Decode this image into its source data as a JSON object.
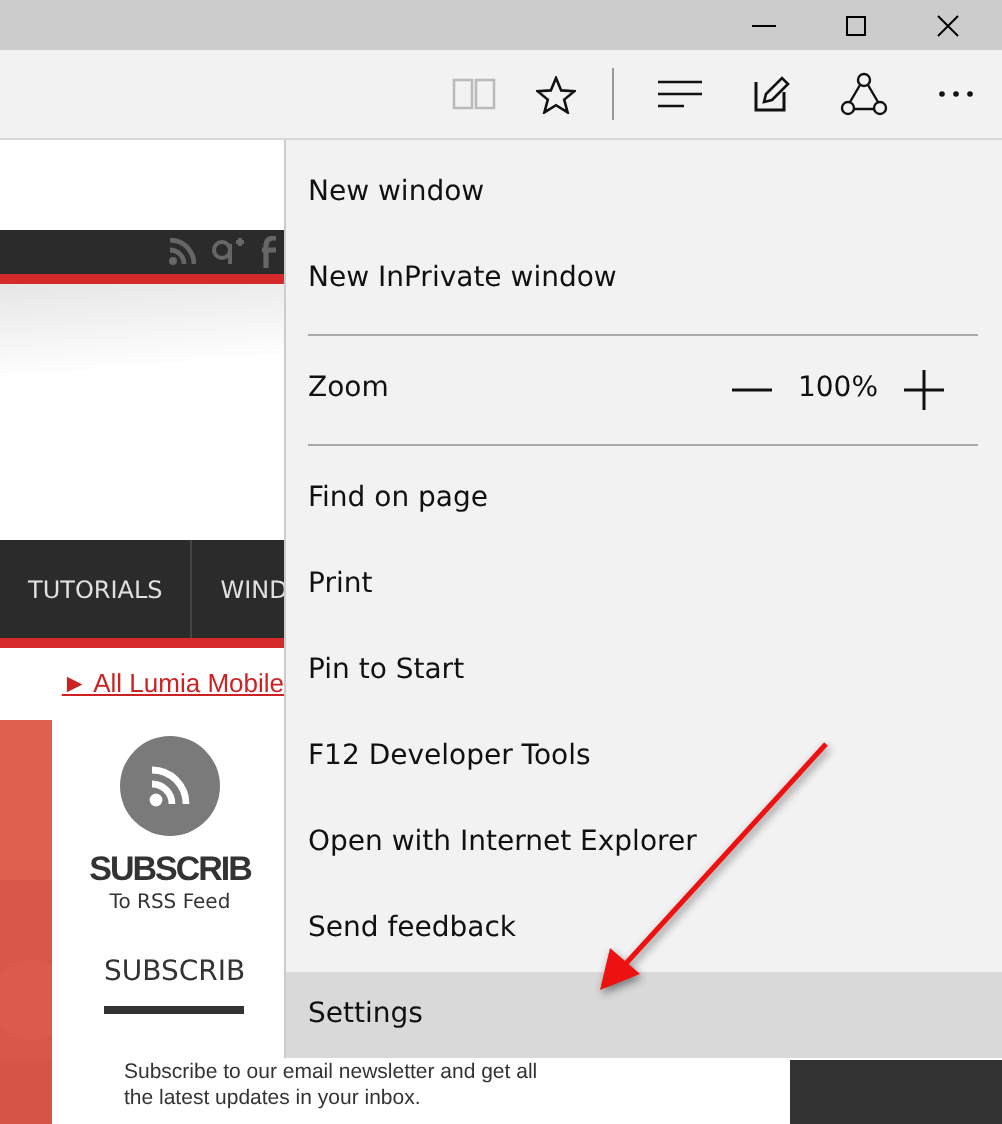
{
  "toolbar": {
    "reading_view_disabled": true
  },
  "site": {
    "nav_items": [
      "TUTORIALS",
      "WIND"
    ],
    "ticker_link": "► All Lumia Mobile",
    "rss_title": "SUBSCRIB",
    "rss_subtitle": "To RSS Feed",
    "section_heading": "SUBSCRIB",
    "newsletter_lines": [
      "Subscribe to our email newsletter and get all",
      "the latest updates in your inbox."
    ]
  },
  "menu": [
    {
      "kind": "item",
      "label": "New window",
      "selected": false
    },
    {
      "kind": "item",
      "label": "New InPrivate window",
      "selected": false
    },
    {
      "kind": "divider"
    },
    {
      "kind": "zoom",
      "label": "Zoom",
      "value": "100%"
    },
    {
      "kind": "divider"
    },
    {
      "kind": "item",
      "label": "Find on page",
      "selected": false
    },
    {
      "kind": "item",
      "label": "Print",
      "selected": false
    },
    {
      "kind": "item",
      "label": "Pin to Start",
      "selected": false
    },
    {
      "kind": "item",
      "label": "F12 Developer Tools",
      "selected": false
    },
    {
      "kind": "item",
      "label": "Open with Internet Explorer",
      "selected": false
    },
    {
      "kind": "item",
      "label": "Send feedback",
      "selected": false
    },
    {
      "kind": "item",
      "label": "Settings",
      "selected": true
    }
  ]
}
